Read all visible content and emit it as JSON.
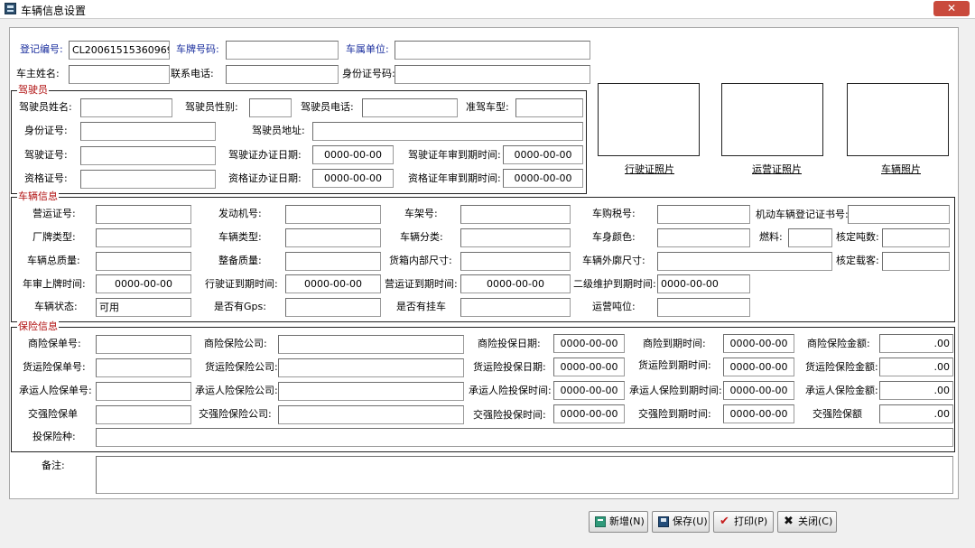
{
  "window": {
    "title": "车辆信息设置",
    "close": "✕"
  },
  "header": {
    "reg_no_label": "登记编号:",
    "reg_no_value": "CL20061515360969",
    "plate_label": "车牌号码:",
    "plate_value": "",
    "unit_label": "车属单位:",
    "unit_value": "",
    "owner_label": "车主姓名:",
    "owner_value": "",
    "phone_label": "联系电话:",
    "phone_value": "",
    "idcard_label": "身份证号码:",
    "idcard_value": ""
  },
  "driver": {
    "title": "驾驶员",
    "name_label": "驾驶员姓名:",
    "name_value": "",
    "gender_label": "驾驶员性别:",
    "gender_value": "",
    "phone_label": "驾驶员电话:",
    "phone_value": "",
    "class_label": "准驾车型:",
    "class_value": "",
    "id_label": "身份证号:",
    "id_value": "",
    "addr_label": "驾驶员地址:",
    "addr_value": "",
    "license_label": "驾驶证号:",
    "license_value": "",
    "license_date_label": "驾驶证办证日期:",
    "license_date_value": "0000-00-00",
    "license_review_label": "驾驶证年审到期时间:",
    "license_review_value": "0000-00-00",
    "qual_label": "资格证号:",
    "qual_value": "",
    "qual_date_label": "资格证办证日期:",
    "qual_date_value": "0000-00-00",
    "qual_review_label": "资格证年审到期时间:",
    "qual_review_value": "0000-00-00"
  },
  "photos": {
    "driving_license": "行驶证照片",
    "operation_cert": "运营证照片",
    "vehicle": "车辆照片"
  },
  "vehicle": {
    "title": "车辆信息",
    "op_cert_label": "营运证号:",
    "op_cert_value": "",
    "engine_label": "发动机号:",
    "engine_value": "",
    "frame_label": "车架号:",
    "frame_value": "",
    "tax_label": "车购税号:",
    "tax_value": "",
    "reg_cert_label": "机动车辆登记证书号:",
    "reg_cert_value": "",
    "brand_label": "厂牌类型:",
    "brand_value": "",
    "vtype_label": "车辆类型:",
    "vtype_value": "",
    "category_label": "车辆分类:",
    "category_value": "",
    "color_label": "车身颜色:",
    "color_value": "",
    "fuel_label": "燃料:",
    "fuel_value": "",
    "tonnage_label": "核定吨数:",
    "tonnage_value": "",
    "gross_label": "车辆总质量:",
    "gross_value": "",
    "curb_label": "整备质量:",
    "curb_value": "",
    "inner_label": "货箱内部尺寸:",
    "inner_value": "",
    "outer_label": "车辆外廓尺寸:",
    "outer_value": "",
    "passengers_label": "核定载客:",
    "passengers_value": "",
    "annual_label": "年审上牌时间:",
    "annual_value": "0000-00-00",
    "dl_expiry_label": "行驶证到期时间:",
    "dl_expiry_value": "0000-00-00",
    "op_expiry_label": "营运证到期时间:",
    "op_expiry_value": "0000-00-00",
    "maint_label": "二级维护到期时间:",
    "maint_value": "0000-00-00",
    "status_label": "车辆状态:",
    "status_value": "可用",
    "gps_label": "是否有Gps:",
    "gps_value": "",
    "trailer_label": "是否有挂车",
    "trailer_value": "",
    "op_ton_label": "运营吨位:",
    "op_ton_value": ""
  },
  "insurance": {
    "title": "保险信息",
    "rows": [
      {
        "no_label": "商险保单号:",
        "no_value": "",
        "co_label": "商险保险公司:",
        "co_value": "",
        "start_label": "商险投保日期:",
        "start_value": "0000-00-00",
        "end_label": "商险到期时间:",
        "end_value": "0000-00-00",
        "amt_label": "商险保险金额:",
        "amt_value": ".00"
      },
      {
        "no_label": "货运险保单号:",
        "no_value": "",
        "co_label": "货运险保险公司:",
        "co_value": "",
        "start_label": "货运险投保日期:",
        "start_value": "0000-00-00",
        "end_label": "货运险到期时间:",
        "end_value": "0000-00-00",
        "amt_label": "货运险保险金额:",
        "amt_value": ".00"
      },
      {
        "no_label": "承运人险保单号:",
        "no_value": "",
        "co_label": "承运人险保险公司:",
        "co_value": "",
        "start_label": "承运人险投保时间:",
        "start_value": "0000-00-00",
        "end_label": "承运人保险到期时间:",
        "end_value": "0000-00-00",
        "amt_label": "承运人保险金额:",
        "amt_value": ".00"
      },
      {
        "no_label": "交强险保单",
        "no_value": "",
        "co_label": "交强险保险公司:",
        "co_value": "",
        "start_label": "交强险投保时间:",
        "start_value": "0000-00-00",
        "end_label": "交强险到期时间:",
        "end_value": "0000-00-00",
        "amt_label": "交强险保额",
        "amt_value": ".00"
      }
    ],
    "type_label": "投保险种:",
    "type_value": ""
  },
  "remarks": {
    "label": "备注:",
    "value": ""
  },
  "buttons": {
    "add": "新增(N)",
    "save": "保存(U)",
    "print": "打印(P)",
    "close": "关闭(C)"
  },
  "icons": {
    "print": "✔",
    "close": "✖"
  }
}
